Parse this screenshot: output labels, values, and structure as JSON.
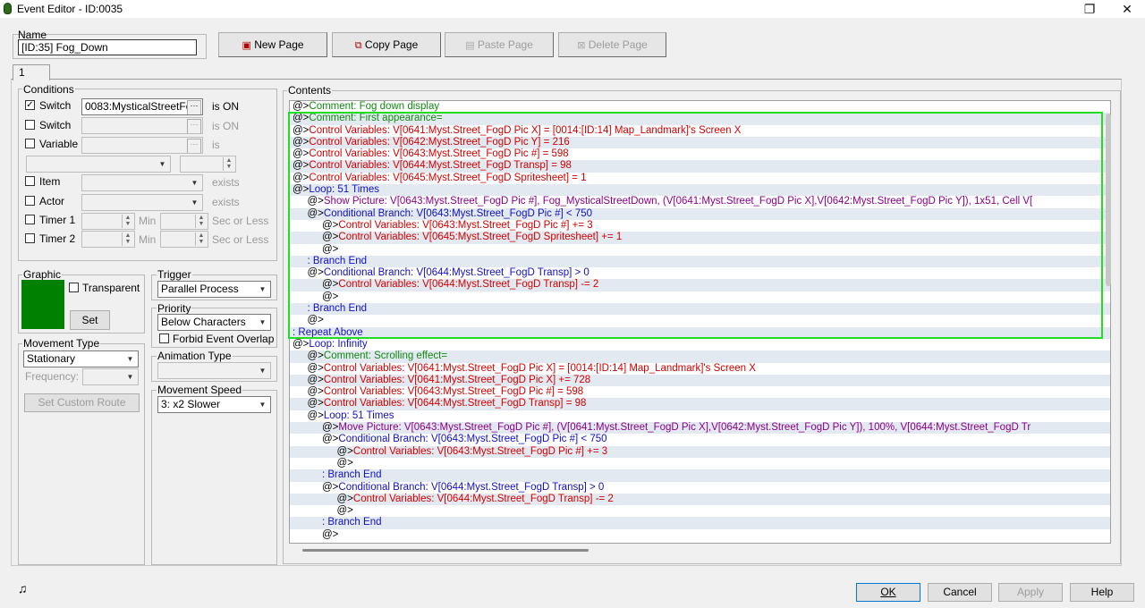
{
  "window": {
    "title": "Event Editor - ID:0035",
    "restore_glyph": "❐",
    "close_glyph": "✕"
  },
  "name": {
    "label": "Name",
    "value": "[ID:35] Fog_Down"
  },
  "toolbar": {
    "new_page": "New Page",
    "copy_page": "Copy Page",
    "paste_page": "Paste Page",
    "delete_page": "Delete Page"
  },
  "page_tab": "1",
  "conditions": {
    "label": "Conditions",
    "switch1": {
      "label": "Switch",
      "value": "0083:MysticalStreetFo",
      "suffix": "is ON",
      "checked": true
    },
    "switch2": {
      "label": "Switch",
      "suffix": "is ON"
    },
    "variable": {
      "label": "Variable",
      "suffix": "is"
    },
    "item": {
      "label": "Item",
      "suffix": "exists"
    },
    "actor": {
      "label": "Actor",
      "suffix": "exists"
    },
    "timer1": {
      "label": "Timer 1",
      "min": "Min",
      "sec": "Sec or Less"
    },
    "timer2": {
      "label": "Timer 2",
      "min": "Min",
      "sec": "Sec or Less"
    }
  },
  "graphic": {
    "label": "Graphic",
    "transparent": "Transparent",
    "set": "Set",
    "color": "#008000"
  },
  "trigger": {
    "label": "Trigger",
    "value": "Parallel Process"
  },
  "priority": {
    "label": "Priority",
    "value": "Below Characters",
    "forbid": "Forbid Event Overlap"
  },
  "movement_type": {
    "label": "Movement Type",
    "value": "Stationary",
    "frequency": "Frequency:",
    "custom_route": "Set Custom Route"
  },
  "animation_type": {
    "label": "Animation Type"
  },
  "movement_speed": {
    "label": "Movement Speed",
    "value": "3: x2 Slower"
  },
  "contents": {
    "label": "Contents",
    "lines": [
      {
        "indent": 0,
        "prefix": "@>",
        "text": "Comment: Fog down display",
        "color": "green"
      },
      {
        "indent": 0,
        "prefix": "@>",
        "text": "Comment: First appearance=",
        "color": "green"
      },
      {
        "indent": 0,
        "prefix": "@>",
        "text": "Control Variables: V[0641:Myst.Street_FogD Pic X] = [0014:[ID:14] Map_Landmark]'s Screen X",
        "color": "red"
      },
      {
        "indent": 0,
        "prefix": "@>",
        "text": "Control Variables: V[0642:Myst.Street_FogD Pic Y] = 216",
        "color": "red"
      },
      {
        "indent": 0,
        "prefix": "@>",
        "text": "Control Variables: V[0643:Myst.Street_FogD Pic #] = 598",
        "color": "red"
      },
      {
        "indent": 0,
        "prefix": "@>",
        "text": "Control Variables: V[0644:Myst.Street_FogD Transp] = 98",
        "color": "red"
      },
      {
        "indent": 0,
        "prefix": "@>",
        "text": "Control Variables: V[0645:Myst.Street_FogD Spritesheet] = 1",
        "color": "red"
      },
      {
        "indent": 0,
        "prefix": "@>",
        "text": "Loop: 51 Times",
        "color": "blue"
      },
      {
        "indent": 1,
        "prefix": "@>",
        "text": "Show Picture: V[0643:Myst.Street_FogD Pic #], Fog_MysticalStreetDown, (V[0641:Myst.Street_FogD Pic X],V[0642:Myst.Street_FogD Pic Y]), 1x51, Cell V[",
        "color": "purple"
      },
      {
        "indent": 1,
        "prefix": "@>",
        "text": "Conditional Branch: V[0643:Myst.Street_FogD Pic #] < 750",
        "color": "blue"
      },
      {
        "indent": 2,
        "prefix": "@>",
        "text": "Control Variables: V[0643:Myst.Street_FogD Pic #] += 3",
        "color": "red"
      },
      {
        "indent": 2,
        "prefix": "@>",
        "text": "Control Variables: V[0645:Myst.Street_FogD Spritesheet] += 1",
        "color": "red"
      },
      {
        "indent": 2,
        "prefix": "@>",
        "text": "",
        "color": "black"
      },
      {
        "indent": 1,
        "prefix": " : ",
        "text": "Branch End",
        "color": "blue"
      },
      {
        "indent": 1,
        "prefix": "@>",
        "text": "Conditional Branch: V[0644:Myst.Street_FogD Transp] > 0",
        "color": "blue"
      },
      {
        "indent": 2,
        "prefix": "@>",
        "text": "Control Variables: V[0644:Myst.Street_FogD Transp] -= 2",
        "color": "red"
      },
      {
        "indent": 2,
        "prefix": "@>",
        "text": "",
        "color": "black"
      },
      {
        "indent": 1,
        "prefix": " : ",
        "text": "Branch End",
        "color": "blue"
      },
      {
        "indent": 1,
        "prefix": "@>",
        "text": "",
        "color": "black"
      },
      {
        "indent": 0,
        "prefix": " : ",
        "text": "Repeat Above",
        "color": "blue"
      },
      {
        "indent": 0,
        "prefix": "@>",
        "text": "Loop: Infinity",
        "color": "blue"
      },
      {
        "indent": 1,
        "prefix": "@>",
        "text": "Comment: Scrolling effect=",
        "color": "green"
      },
      {
        "indent": 1,
        "prefix": "@>",
        "text": "Control Variables: V[0641:Myst.Street_FogD Pic X] = [0014:[ID:14] Map_Landmark]'s Screen X",
        "color": "red"
      },
      {
        "indent": 1,
        "prefix": "@>",
        "text": "Control Variables: V[0641:Myst.Street_FogD Pic X] += 728",
        "color": "red"
      },
      {
        "indent": 1,
        "prefix": "@>",
        "text": "Control Variables: V[0643:Myst.Street_FogD Pic #] = 598",
        "color": "red"
      },
      {
        "indent": 1,
        "prefix": "@>",
        "text": "Control Variables: V[0644:Myst.Street_FogD Transp] = 98",
        "color": "red"
      },
      {
        "indent": 1,
        "prefix": "@>",
        "text": "Loop: 51 Times",
        "color": "blue"
      },
      {
        "indent": 2,
        "prefix": "@>",
        "text": "Move Picture: V[0643:Myst.Street_FogD Pic #], (V[0641:Myst.Street_FogD Pic X],V[0642:Myst.Street_FogD Pic Y]), 100%, V[0644:Myst.Street_FogD Tr",
        "color": "purple"
      },
      {
        "indent": 2,
        "prefix": "@>",
        "text": "Conditional Branch: V[0643:Myst.Street_FogD Pic #] < 750",
        "color": "blue"
      },
      {
        "indent": 3,
        "prefix": "@>",
        "text": "Control Variables: V[0643:Myst.Street_FogD Pic #] += 3",
        "color": "red"
      },
      {
        "indent": 3,
        "prefix": "@>",
        "text": "",
        "color": "black"
      },
      {
        "indent": 2,
        "prefix": " : ",
        "text": "Branch End",
        "color": "blue"
      },
      {
        "indent": 2,
        "prefix": "@>",
        "text": "Conditional Branch: V[0644:Myst.Street_FogD Transp] > 0",
        "color": "blue"
      },
      {
        "indent": 3,
        "prefix": "@>",
        "text": "Control Variables: V[0644:Myst.Street_FogD Transp] -= 2",
        "color": "red"
      },
      {
        "indent": 3,
        "prefix": "@>",
        "text": "",
        "color": "black"
      },
      {
        "indent": 2,
        "prefix": " : ",
        "text": "Branch End",
        "color": "blue"
      },
      {
        "indent": 2,
        "prefix": "@>",
        "text": "",
        "color": "black"
      }
    ]
  },
  "footer": {
    "ok": "OK",
    "cancel": "Cancel",
    "apply": "Apply",
    "help": "Help",
    "music_glyph": "♫"
  }
}
